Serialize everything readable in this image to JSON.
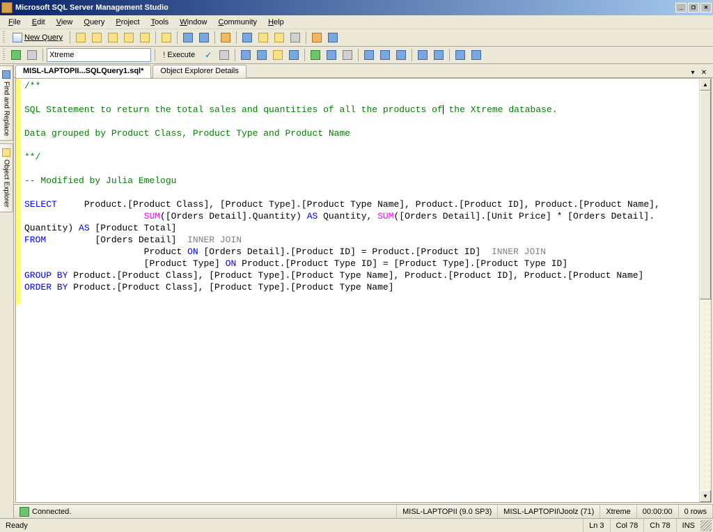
{
  "window": {
    "title": "Microsoft SQL Server Management Studio"
  },
  "menu": {
    "file": "File",
    "edit": "Edit",
    "view": "View",
    "query": "Query",
    "project": "Project",
    "tools": "Tools",
    "window": "Window",
    "community": "Community",
    "help": "Help"
  },
  "toolbar1": {
    "newquery": "New Query"
  },
  "toolbar2": {
    "database": "Xtreme",
    "execute": "Execute"
  },
  "sidetabs": {
    "findreplace": "Find and Replace",
    "objectexplorer": "Object Explorer"
  },
  "tabs": {
    "active": "MISL-LAPTOPII...SQLQuery1.sql*",
    "other": "Object Explorer Details"
  },
  "sql": {
    "l1": "/**",
    "l2": "",
    "l3a": "SQL Statement to return the total sales and quantities of all the products of",
    "l3b": " the Xtreme database.",
    "l4": "",
    "l5": "Data grouped by Product Class, Product Type and Product Name",
    "l6": "",
    "l7": "**/",
    "l8": "",
    "l9": "-- Modified by Julia Emelogu",
    "l10": "",
    "kw_select": "SELECT",
    "sel_cols": "     Product.[Product Class], [Product Type].[Product Type Name], Product.[Product ID], Product.[Product Name],",
    "indent_sum": "                      ",
    "kw_sum1": "SUM",
    "sum1_body": "([Orders Detail].Quantity) ",
    "kw_as1": "AS",
    "as1_body": " Quantity, ",
    "kw_sum2": "SUM",
    "sum2_body": "([Orders Detail].[Unit Price] * [Orders Detail].",
    "l13a": "Quantity) ",
    "kw_as2": "AS",
    "l13b": " [Product Total]",
    "kw_from": "FROM",
    "from_pad": "         ",
    "from_body": "[Orders Detail]  ",
    "kw_ij1": "INNER JOIN",
    "indent_join": "                      ",
    "join1_a": "Product ",
    "kw_on1": "ON",
    "join1_b": " [Orders Detail].[Product ID] = Product.[Product ID]  ",
    "kw_ij2": "INNER JOIN",
    "join2_a": "[Product Type] ",
    "kw_on2": "ON",
    "join2_b": " Product.[Product Type ID] = [Product Type].[Product Type ID]",
    "kw_groupby": "GROUP BY",
    "gb_body": " Product.[Product Class], [Product Type].[Product Type Name], Product.[Product ID], Product.[Product Name]",
    "kw_orderby": "ORDER BY",
    "ob_body": " Product.[Product Class], [Product Type].[Product Type Name]"
  },
  "connbar": {
    "status": "Connected.",
    "server": "MISL-LAPTOPII (9.0 SP3)",
    "user": "MISL-LAPTOPII\\Joolz (71)",
    "db": "Xtreme",
    "time": "00:00:00",
    "rows": "0 rows"
  },
  "statusbar": {
    "ready": "Ready",
    "ln": "Ln 3",
    "col": "Col 78",
    "ch": "Ch 78",
    "ins": "INS"
  }
}
